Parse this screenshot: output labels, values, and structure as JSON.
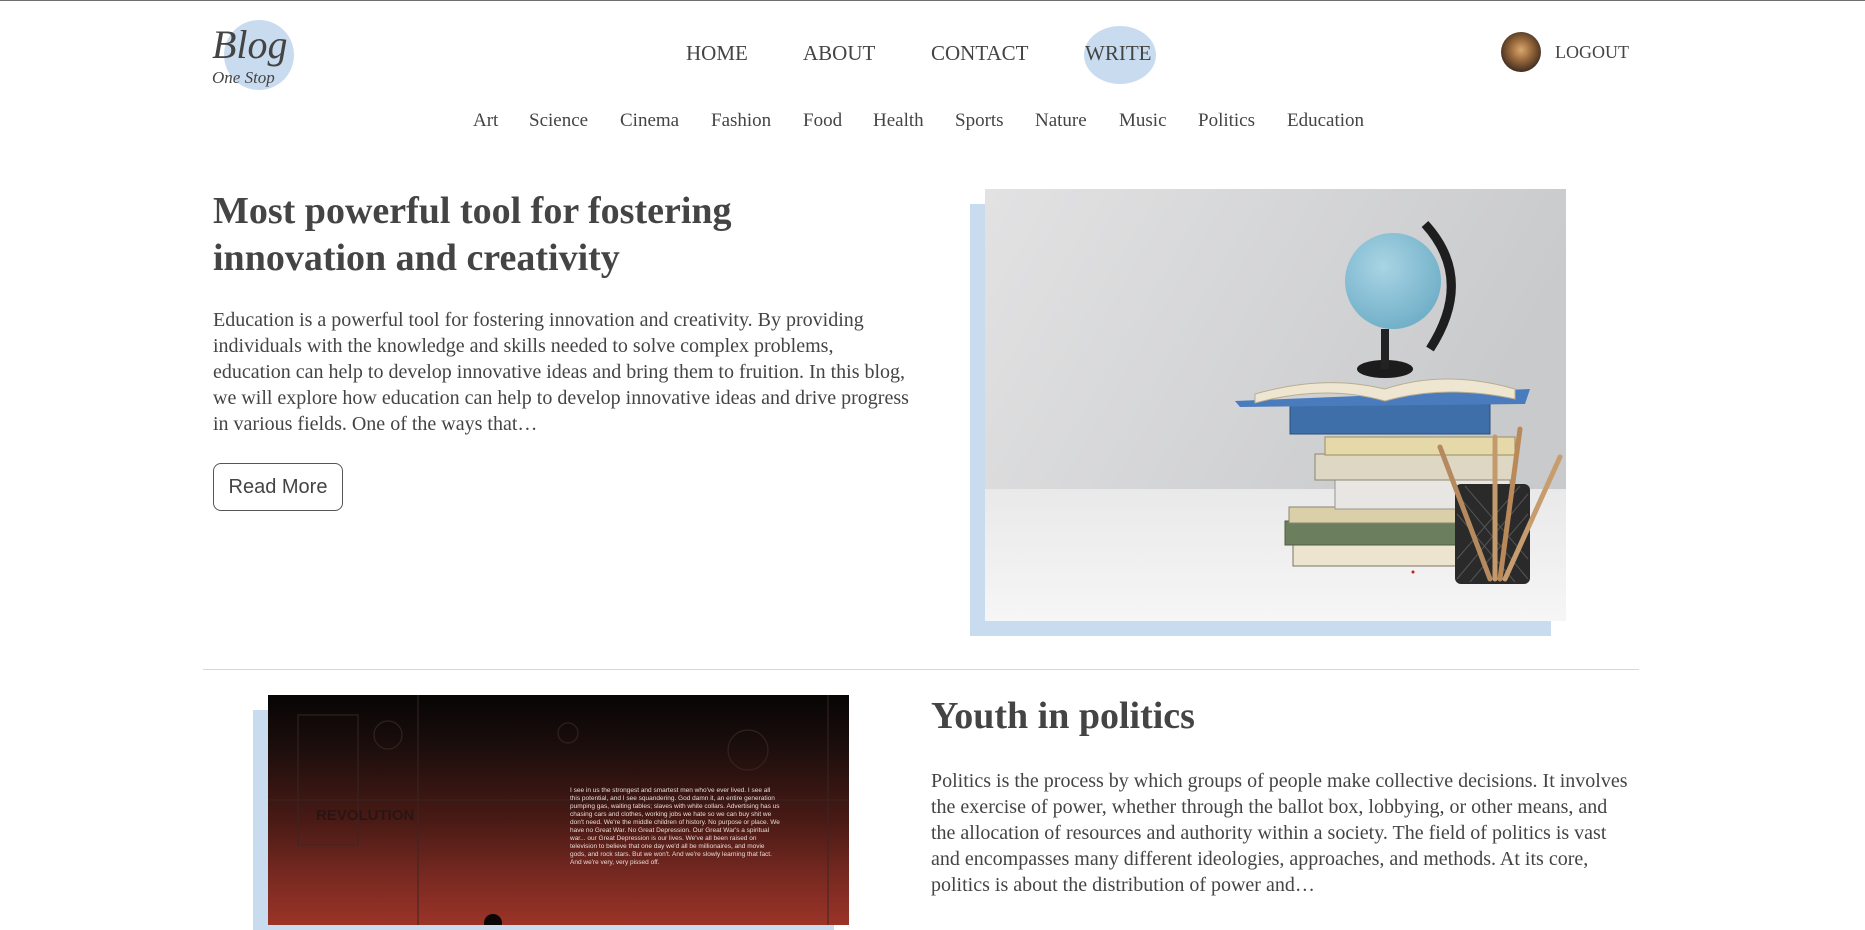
{
  "header": {
    "logo_main": "Blog",
    "logo_sub": "One Stop",
    "nav": [
      "HOME",
      "ABOUT",
      "CONTACT",
      "WRITE"
    ],
    "logout_label": "LOGOUT"
  },
  "categories": [
    "Art",
    "Science",
    "Cinema",
    "Fashion",
    "Food",
    "Health",
    "Sports",
    "Nature",
    "Music",
    "Politics",
    "Education"
  ],
  "posts": [
    {
      "title": "Most powerful tool for fostering innovation and creativity",
      "desc": "Education is a powerful tool for fostering innovation and creativity. By providing individuals with the knowledge and skills needed to solve complex problems, education can help to develop innovative ideas and bring them to fruition. In this blog, we will explore how education can help to develop innovative ideas and drive progress in various fields. One of the ways that…",
      "button_label": "Read More",
      "image_icon": "globe-books-pencils-image"
    },
    {
      "title": "Youth in politics",
      "desc": "Politics is the process by which groups of people make collective decisions. It involves the exercise of power, whether through the ballot box, lobbying, or other means, and the allocation of resources and authority within a society. The field of politics is vast and encompasses many different ideologies, approaches, and methods. At its core, politics is about the distribution of power and…",
      "image_icon": "revolution-poster-image",
      "image_text": "REVOLUTION",
      "image_quote": "I see in us the strongest and smartest men who've ever lived. I see all this potential, and I see squandering. God damn it, an entire generation pumping gas, waiting tables; slaves with white collars. Advertising has us chasing cars and clothes, working jobs we hate so we can buy shit we don't need. We're the middle children of history. No purpose or place. We have no Great War. No Great Depression. Our Great War's a spiritual war... our Great Depression is our lives. We've all been raised on television to believe that one day we'd all be millionaires, and movie gods, and rock stars. But we won't. And we're slowly learning that fact. And we're very, very pissed off."
    }
  ],
  "colors": {
    "accent": "#c9dcef",
    "text": "#444444",
    "divider": "#c9dcef"
  }
}
